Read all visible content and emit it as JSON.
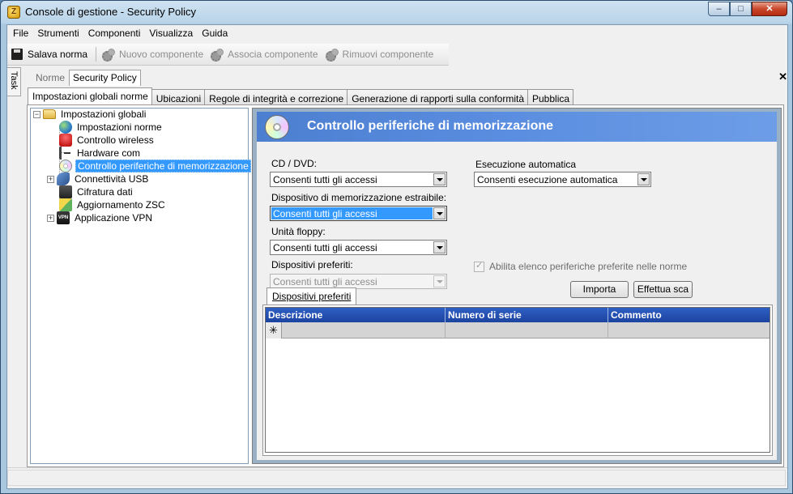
{
  "window": {
    "title": "Console di gestione  - Security Policy",
    "buttons": {
      "minimize": "–",
      "maximize": "□",
      "close": "✕"
    }
  },
  "menu": [
    "File",
    "Strumenti",
    "Componenti",
    "Visualizza",
    "Guida"
  ],
  "toolbar": {
    "save": "Salava norma",
    "new_component": "Nuovo componente",
    "associate_component": "Associa componente",
    "remove_component": "Rimuovi componente"
  },
  "task_label": "Task",
  "doc_tabs": [
    "Norme",
    "Security Policy"
  ],
  "doc_close": "✕",
  "sub_tabs": [
    "Impostazioni globali norme",
    "Ubicazioni",
    "Regole di integrità e correzione",
    "Generazione di rapporti sulla conformità",
    "Pubblica"
  ],
  "tree": {
    "root": "Impostazioni globali",
    "items": [
      "Impostazioni norme",
      "Controllo wireless",
      "Hardware com",
      "Controllo periferiche di memorizzazione",
      "Connettività USB",
      "Cifratura dati",
      "Aggiornamento ZSC",
      "Applicazione VPN"
    ]
  },
  "panel": {
    "title": "Controllo periferiche di memorizzazione",
    "cd_dvd_label": "CD / DVD:",
    "cd_dvd_value": "Consenti tutti gli accessi",
    "removable_label": "Dispositivo di memorizzazione estraibile:",
    "removable_value": "Consenti tutti gli accessi",
    "floppy_label": "Unità floppy:",
    "floppy_value": "Consenti tutti gli accessi",
    "preferred_label": "Dispositivi preferiti:",
    "preferred_value": "Consenti tutti gli accessi",
    "autorun_label": "Esecuzione automatica",
    "autorun_value": "Consenti esecuzione automatica",
    "enable_preferred_label": "Abilita elenco periferiche preferite nelle norme",
    "import_button": "Importa",
    "scan_button": "Effettua sca",
    "inner_tab": "Dispositivi preferiti",
    "grid_columns": [
      "Descrizione",
      "Numero di serie",
      "Commento"
    ],
    "new_row_marker": "✳"
  }
}
